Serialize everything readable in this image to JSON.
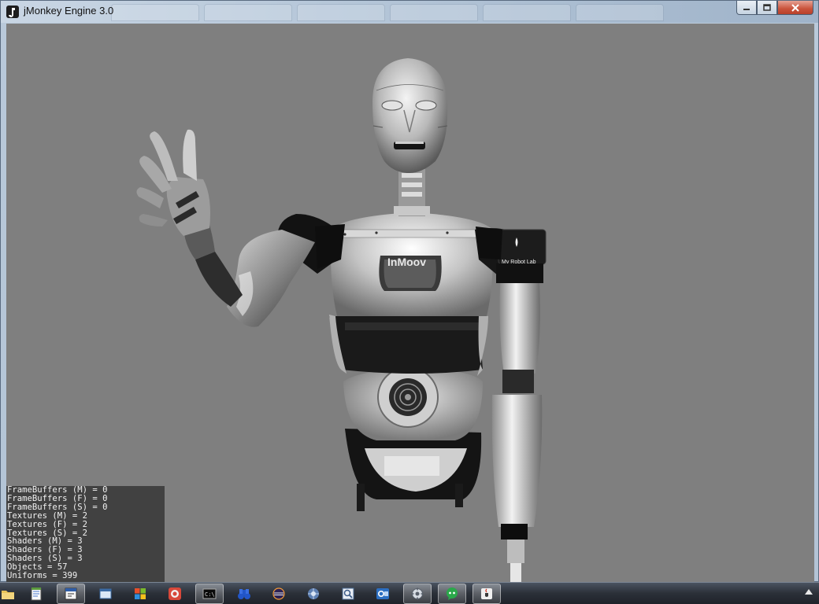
{
  "window": {
    "title": "jMonkey Engine 3.0"
  },
  "viewport": {
    "background": "#7f7f7f",
    "chest_logo": "InMoov",
    "shoulder_label": "My Robot Lab"
  },
  "stats": [
    "FrameBuffers (M) = 0",
    "FrameBuffers (F) = 0",
    "FrameBuffers (S) = 0",
    "Textures (M) = 2",
    "Textures (F) = 2",
    "Textures (S) = 2",
    "Shaders (M) = 3",
    "Shaders (F) = 3",
    "Shaders (S) = 3",
    "Objects = 57",
    "Uniforms = 399"
  ],
  "taskbar": {
    "items": [
      {
        "icon": "folder-icon",
        "active": false
      },
      {
        "icon": "notepad-icon",
        "active": false
      },
      {
        "icon": "editor-icon",
        "active": true
      },
      {
        "icon": "window-icon",
        "active": false
      },
      {
        "icon": "windows-flag-icon",
        "active": false
      },
      {
        "icon": "chrome-icon",
        "active": false
      },
      {
        "icon": "terminal-icon",
        "active": true
      },
      {
        "icon": "binoculars-icon",
        "active": false
      },
      {
        "icon": "eclipse-icon",
        "active": false
      },
      {
        "icon": "network-icon",
        "active": false
      },
      {
        "icon": "search-window-icon",
        "active": false
      },
      {
        "icon": "outlook-icon",
        "active": false
      },
      {
        "icon": "settings-icon",
        "active": true
      },
      {
        "icon": "chat-icon",
        "active": true
      },
      {
        "icon": "java-icon",
        "active": true
      }
    ]
  }
}
